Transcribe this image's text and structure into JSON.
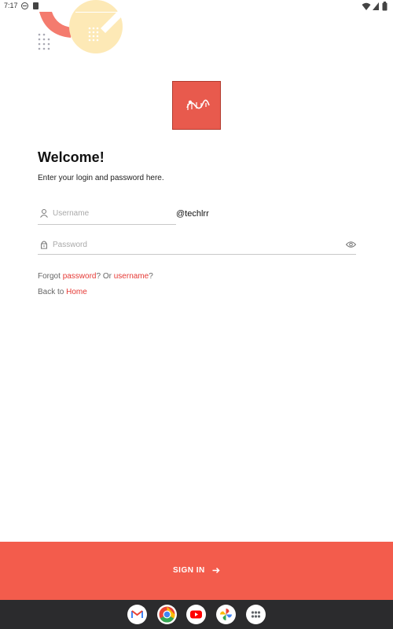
{
  "status_bar": {
    "time": "7:17",
    "icons": [
      "do-not-disturb-icon",
      "sd-card-icon",
      "wifi-icon",
      "signal-icon",
      "battery-icon"
    ]
  },
  "app": {
    "logo_name": "app-logo",
    "accent_color": "#f35c4c",
    "link_color": "#e53935"
  },
  "login": {
    "title": "Welcome!",
    "subtitle": "Enter your login and password here.",
    "username_placeholder": "Username",
    "username_suffix": "@techlrr",
    "password_placeholder": "Password",
    "forgot_prefix": "Forgot ",
    "forgot_password_link": "password",
    "forgot_middle": "? Or ",
    "forgot_username_link": "username",
    "forgot_suffix": "?",
    "back_prefix": "Back to ",
    "back_home_link": "Home",
    "sign_in_label": "SIGN IN"
  },
  "nav_bar": {
    "apps": [
      "Gmail",
      "Chrome",
      "YouTube",
      "Photos",
      "App drawer"
    ]
  }
}
